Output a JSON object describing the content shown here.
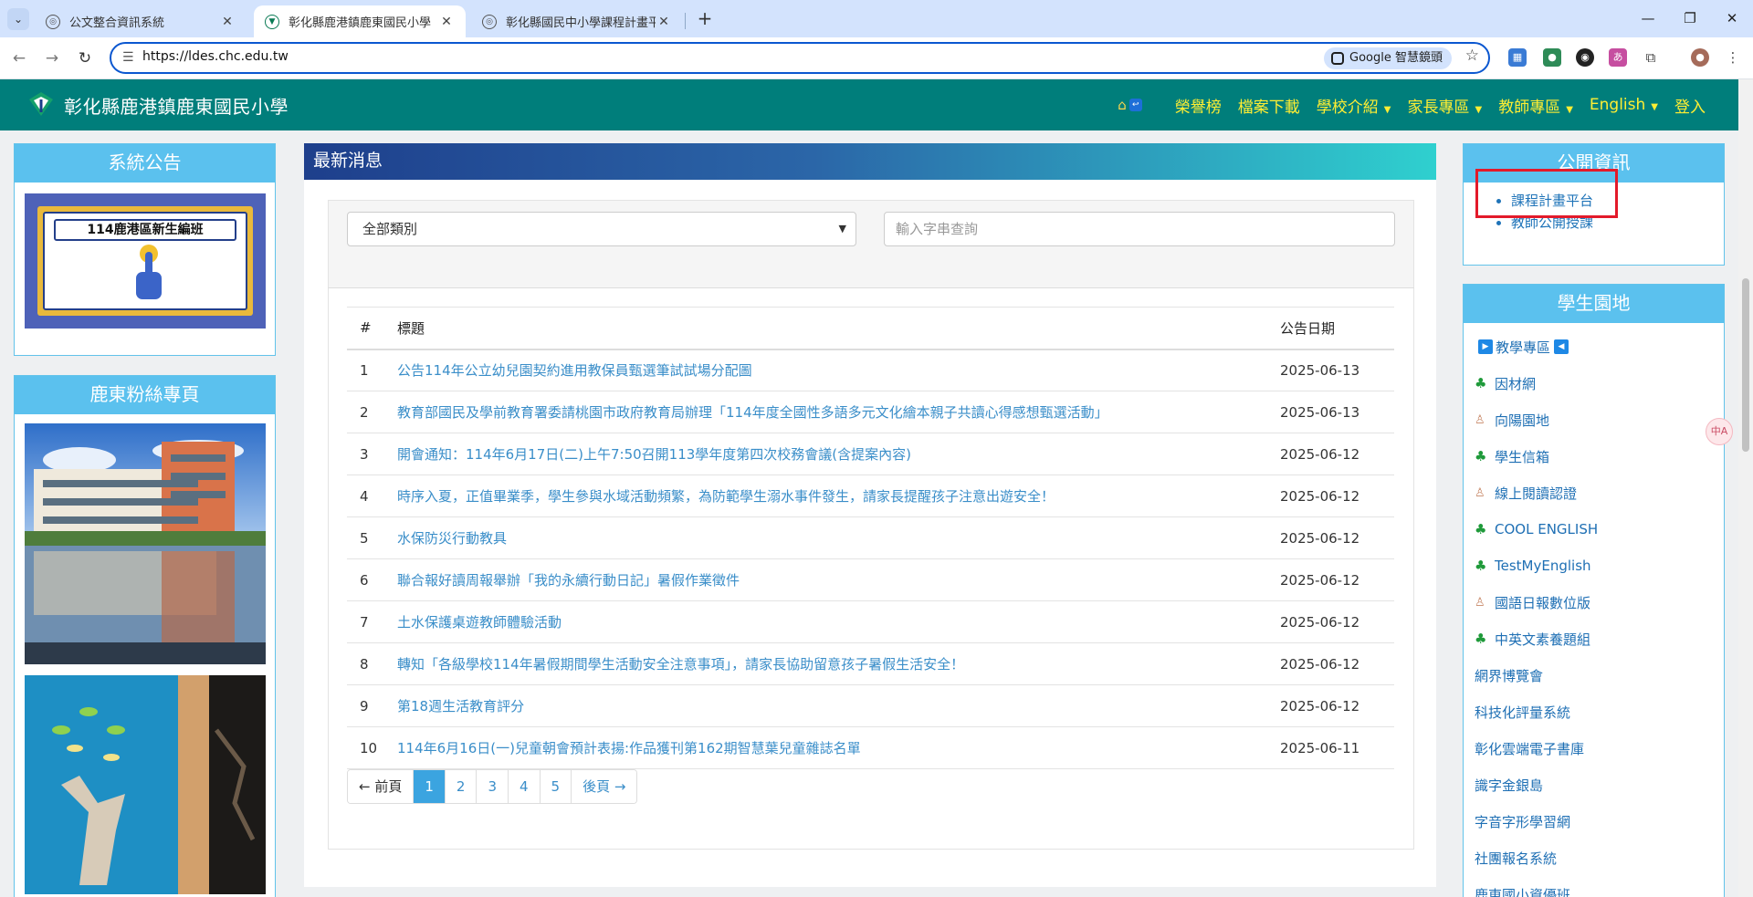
{
  "browser": {
    "tabs": [
      {
        "title": "公文整合資訊系統",
        "active": false
      },
      {
        "title": "彰化縣鹿港鎮鹿東國民小學",
        "active": true
      },
      {
        "title": "彰化縣國民中小學課程計畫平台",
        "active": false
      }
    ],
    "new_tab": "+",
    "url": "https://ldes.chc.edu.tw",
    "lens_label": "Google 智慧鏡頭"
  },
  "site": {
    "title": "彰化縣鹿港鎮鹿東國民小學",
    "nav": [
      {
        "label": "榮譽榜",
        "dropdown": false
      },
      {
        "label": "檔案下載",
        "dropdown": false
      },
      {
        "label": "學校介紹",
        "dropdown": true
      },
      {
        "label": "家長專區",
        "dropdown": true
      },
      {
        "label": "教師專區",
        "dropdown": true
      },
      {
        "label": "English",
        "dropdown": true
      },
      {
        "label": "登入",
        "dropdown": false
      }
    ]
  },
  "left_sidebar": {
    "notice_title": "系統公告",
    "notice_image_text": "114鹿港區新生編班",
    "fans_title": "鹿東粉絲專頁"
  },
  "news": {
    "title": "最新消息",
    "category_select": "全部類別",
    "search_placeholder": "輸入字串查詢",
    "columns": {
      "num": "#",
      "title": "標題",
      "date": "公告日期"
    },
    "rows": [
      {
        "num": "1",
        "title": "公告114年公立幼兒園契約進用教保員甄選筆試試場分配圖",
        "date": "2025-06-13"
      },
      {
        "num": "2",
        "title": "教育部國民及學前教育署委請桃園市政府教育局辦理「114年度全國性多語多元文化繪本親子共讀心得感想甄選活動」",
        "date": "2025-06-13"
      },
      {
        "num": "3",
        "title": "開會通知：114年6月17日(二)上午7:50召開113學年度第四次校務會議(含提案內容)",
        "date": "2025-06-12"
      },
      {
        "num": "4",
        "title": "時序入夏，正值畢業季，學生參與水域活動頻繁，為防範學生溺水事件發生，請家長提醒孩子注意出遊安全！",
        "date": "2025-06-12"
      },
      {
        "num": "5",
        "title": "水保防災行動教具",
        "date": "2025-06-12"
      },
      {
        "num": "6",
        "title": "聯合報好讀周報舉辦「我的永續行動日記」暑假作業徵件",
        "date": "2025-06-12"
      },
      {
        "num": "7",
        "title": "土水保護桌遊教師體驗活動",
        "date": "2025-06-12"
      },
      {
        "num": "8",
        "title": "轉知「各級學校114年暑假期間學生活動安全注意事項」，請家長協助留意孩子暑假生活安全！",
        "date": "2025-06-12"
      },
      {
        "num": "9",
        "title": "第18週生活教育評分",
        "date": "2025-06-12"
      },
      {
        "num": "10",
        "title": "114年6月16日(一)兒童朝會預計表揚:作品獲刊第162期智慧葉兒童雜誌名單",
        "date": "2025-06-11"
      }
    ],
    "pager": {
      "prev": "← 前頁",
      "pages": [
        "1",
        "2",
        "3",
        "4",
        "5"
      ],
      "current": "1",
      "next": "後頁 →"
    }
  },
  "right_sidebar": {
    "open_info_title": "公開資訊",
    "open_info_items": [
      "課程計畫平台",
      "教師公開授課"
    ],
    "student_title": "學生園地",
    "student_items": [
      {
        "label": "教學專區",
        "icon": "play"
      },
      {
        "label": "因材網",
        "icon": "clover"
      },
      {
        "label": "向陽園地",
        "icon": "bottle"
      },
      {
        "label": "學生信箱",
        "icon": "clover"
      },
      {
        "label": "線上閱讀認證",
        "icon": "bottle"
      },
      {
        "label": "COOL ENGLISH",
        "icon": "clover"
      },
      {
        "label": "TestMyEnglish",
        "icon": "clover"
      },
      {
        "label": "國語日報數位版",
        "icon": "bottle"
      },
      {
        "label": "中英文素養題組",
        "icon": "clover"
      },
      {
        "label": "網界博覽會",
        "icon": "none"
      },
      {
        "label": "科技化評量系統",
        "icon": "none"
      },
      {
        "label": "彰化雲端電子書庫",
        "icon": "none"
      },
      {
        "label": "識字金銀島",
        "icon": "none"
      },
      {
        "label": "字音字形學習網",
        "icon": "none"
      },
      {
        "label": "社團報名系統",
        "icon": "none"
      },
      {
        "label": "鹿東國小資優班",
        "icon": "none"
      }
    ]
  }
}
